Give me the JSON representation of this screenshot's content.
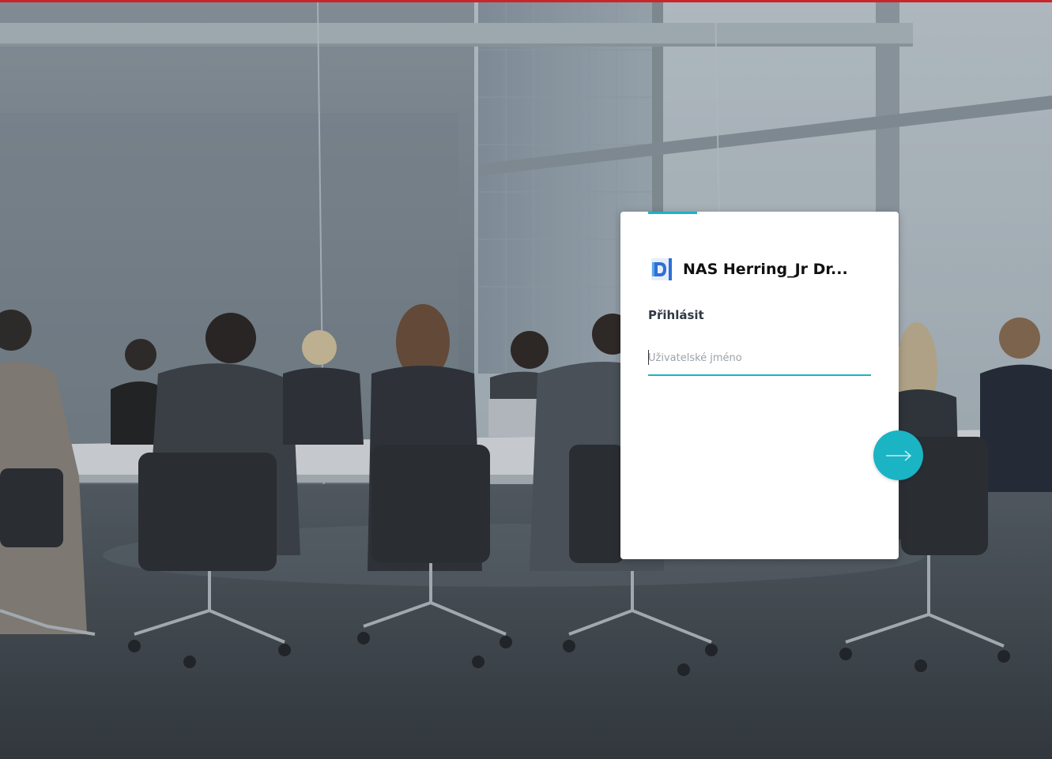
{
  "login": {
    "app_title": "NAS Herring_Jr Dr...",
    "heading": "Přihlásit",
    "username_placeholder": "Uživatelské jméno",
    "username_value": ""
  },
  "icons": {
    "logo": "app-logo-icon",
    "submit": "arrow-right-icon"
  },
  "colors": {
    "accent": "#1ab4c4",
    "top_bar": "#c8262b",
    "card_bg": "#ffffff",
    "logo_blue": "#2f6fd6"
  }
}
